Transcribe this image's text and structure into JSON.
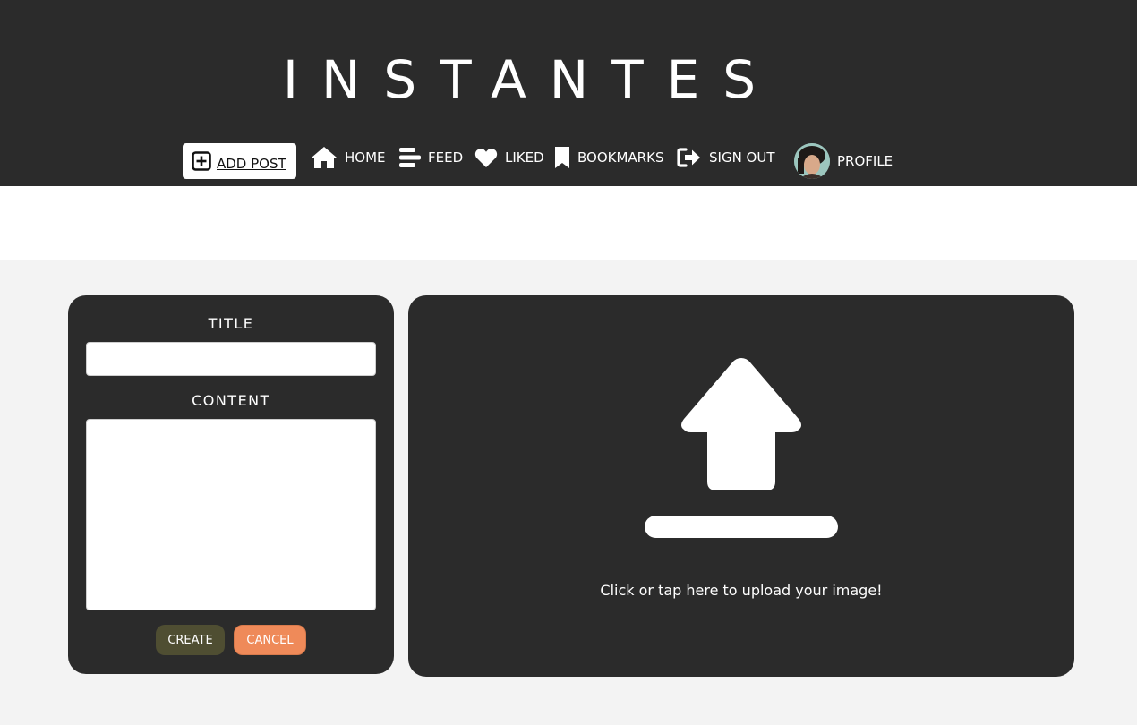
{
  "header": {
    "brand": "INSTANTES",
    "nav": {
      "add_post": "ADD POST",
      "home": "HOME",
      "feed": "FEED",
      "liked": "LIKED",
      "bookmarks": "BOOKMARKS",
      "sign_out": "SIGN OUT",
      "profile": "PROFILE"
    }
  },
  "form": {
    "title_label": "TITLE",
    "title_value": "",
    "content_label": "CONTENT",
    "content_value": "",
    "create_label": "CREATE",
    "cancel_label": "CANCEL"
  },
  "upload": {
    "prompt": "Click or tap here to upload your image!",
    "icon": "upload-icon"
  },
  "colors": {
    "header_bg": "#2b2b2b",
    "panel_bg": "#2b2b2b",
    "page_bg": "#f3f3f3",
    "create_button": "#4f4e32",
    "cancel_button": "#ef8a59"
  }
}
